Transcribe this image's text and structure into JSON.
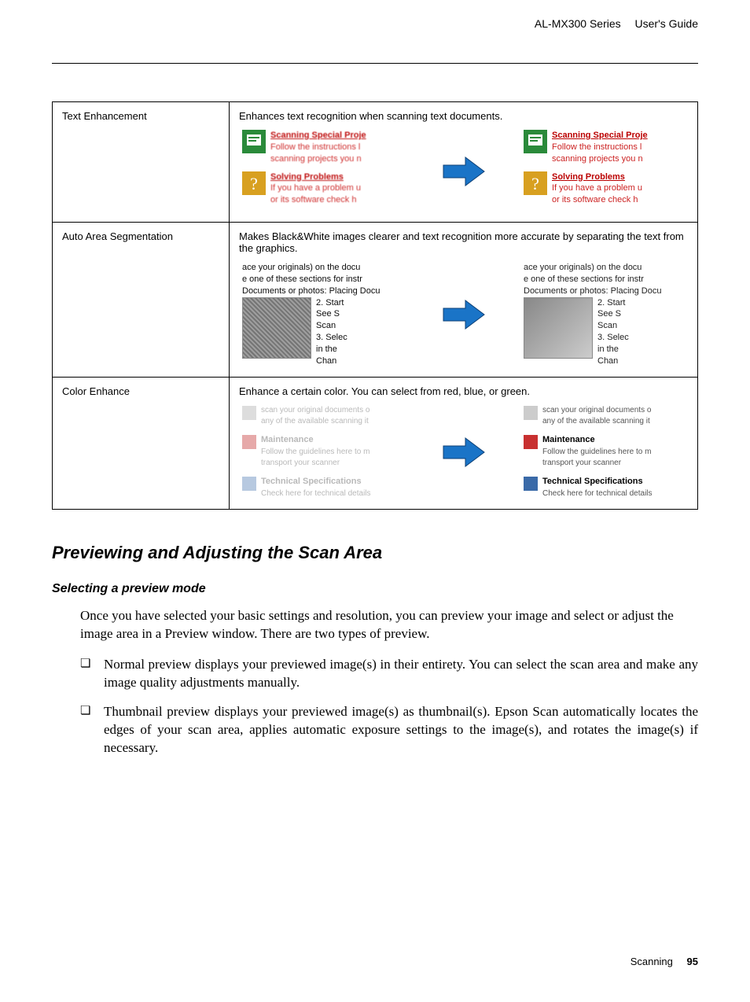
{
  "header": {
    "series": "AL-MX300 Series",
    "guide": "User's Guide"
  },
  "table": {
    "rows": [
      {
        "name": "Text Enhancement",
        "desc": "Enhances text recognition when scanning text documents.",
        "te": {
          "block1": {
            "head": "Scanning Special Proje",
            "l1": "Follow the instructions l",
            "l2": "scanning projects you n"
          },
          "block2": {
            "head": "Solving Problems",
            "l1": "If you have a problem u",
            "l2": "or its software  check h"
          }
        }
      },
      {
        "name": "Auto Area Segmentation",
        "desc": "Makes Black&White images clearer and text recognition more accurate by separating the text from the graphics.",
        "aa": {
          "top1": "ace your originals) on the docu",
          "top2": "e one of these sections for instr",
          "top3": "Documents or photos: Placing Docu",
          "li1": "2. Start",
          "li2": "See S",
          "li3": "Scan",
          "li4": "3. Selec",
          "li5": "in the",
          "li6": "Chan"
        }
      },
      {
        "name": "Color Enhance",
        "desc": "Enhance a certain color. You can select from red, blue, or green.",
        "ce": {
          "b1": {
            "l1": "scan your original documents o",
            "l2": "any of the available scanning it"
          },
          "b2": {
            "head": "Maintenance",
            "l1": "Follow the guidelines here to m",
            "l2": "transport your scanner"
          },
          "b3": {
            "head": "Technical Specifications",
            "l1": "Check here for technical details"
          }
        }
      }
    ]
  },
  "section": {
    "h2": "Previewing and Adjusting the Scan Area",
    "h3": "Selecting a preview mode",
    "p1": "Once you have selected your basic settings and resolution, you can preview your image and select or adjust the image area in a Preview window. There are two types of preview.",
    "li1": "Normal preview displays your previewed image(s) in their entirety. You can select the scan area and make any image quality adjustments manually.",
    "li2": "Thumbnail preview displays your previewed image(s) as thumbnail(s). Epson Scan automatically locates the edges of your scan area, applies automatic exposure settings to the image(s), and rotates the image(s) if necessary."
  },
  "footer": {
    "chapter": "Scanning",
    "page": "95"
  }
}
